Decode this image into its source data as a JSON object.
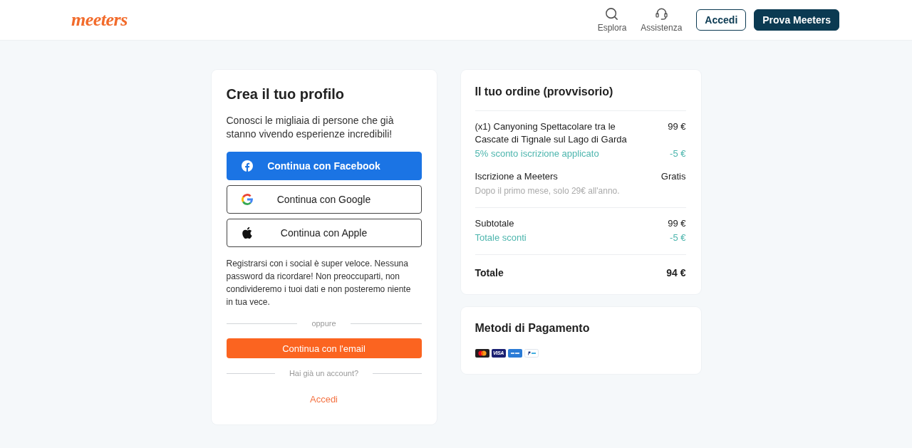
{
  "header": {
    "logo": "meeters",
    "nav": [
      {
        "kind": "search",
        "label": "Esplora"
      },
      {
        "kind": "support",
        "label": "Assistenza"
      }
    ],
    "buttons": [
      {
        "kind": "outline",
        "label": "Accedi"
      },
      {
        "kind": "primary",
        "label": "Prova Meeters"
      }
    ]
  },
  "signup": {
    "title": "Crea il tuo profilo",
    "subtitle": "Conosci le migliaia di persone che già stanno vivendo esperienze incredibili!",
    "social_buttons": [
      {
        "kind": "facebook",
        "label": "Continua con Facebook"
      },
      {
        "kind": "google",
        "label": "Continua con Google"
      },
      {
        "kind": "apple",
        "label": "Continua con Apple"
      }
    ],
    "note": "Registrarsi con i social è super veloce. Nessuna password da ricordare! Non preoccuparti, non condivideremo i tuoi dati e non posteremo niente in tua vece.",
    "divider": "oppure",
    "email_button": "Continua con l'email",
    "login_prompt": "Hai già un account?",
    "login_link": "Accedi"
  },
  "order": {
    "title": "Il tuo ordine (provvisorio)",
    "sections": [
      {
        "lines": [
          {
            "kind": "item",
            "label": "(x1) Canyoning Spettacolare tra le Cascate di Tignale sul Lago di Garda",
            "amount": "99 €"
          },
          {
            "kind": "discount",
            "label": "5% sconto iscrizione applicato",
            "amount": "-5 €"
          },
          {
            "kind": "item",
            "label": "Iscrizione a Meeters",
            "amount": "Gratis"
          },
          {
            "kind": "note",
            "label": "Dopo il primo mese, solo 29€ all'anno."
          }
        ]
      },
      {
        "lines": [
          {
            "kind": "item",
            "label": "Subtotale",
            "amount": "99 €"
          },
          {
            "kind": "discount",
            "label": "Totale sconti",
            "amount": "-5 €"
          }
        ]
      },
      {
        "lines": [
          {
            "kind": "total",
            "label": "Totale",
            "amount": "94 €"
          }
        ]
      }
    ]
  },
  "payment": {
    "title": "Metodi di Pagamento",
    "methods": [
      {
        "kind": "mastercard"
      },
      {
        "kind": "visa",
        "label": "VISA"
      },
      {
        "kind": "amex"
      },
      {
        "kind": "paypal"
      }
    ]
  }
}
